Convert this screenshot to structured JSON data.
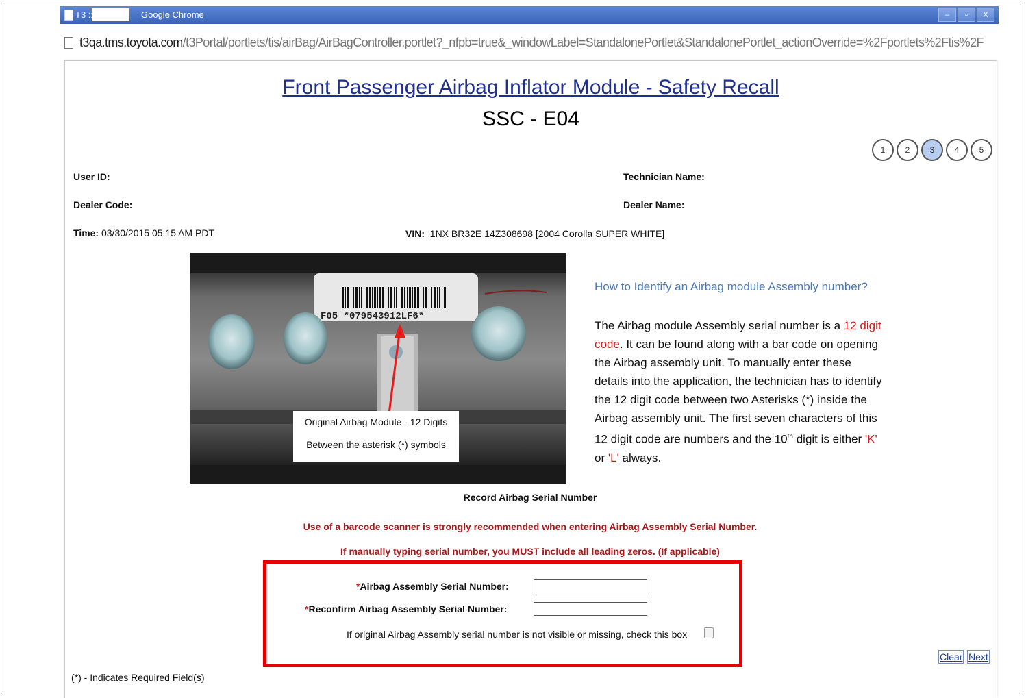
{
  "window": {
    "tab_title_prefix": "T3 ::",
    "app_name": "Google Chrome",
    "controls": [
      "–",
      "▫",
      "X"
    ]
  },
  "address_bar": {
    "host": "t3qa.tms.toyota.com",
    "path": "/t3Portal/portlets/tis/airBag/AirBagController.portlet?_nfpb=true&_windowLabel=StandalonePortlet&StandalonePortlet_actionOverride=%2Fportlets%2Ftis%2F"
  },
  "page": {
    "title": "Front Passenger Airbag Inflator Module - Safety Recall",
    "subtitle": "SSC - E04"
  },
  "steps": [
    {
      "label": "1",
      "active": false
    },
    {
      "label": "2",
      "active": false
    },
    {
      "label": "3",
      "active": true
    },
    {
      "label": "4",
      "active": false
    },
    {
      "label": "5",
      "active": false
    }
  ],
  "info": {
    "user_id_label": "User ID:",
    "dealer_code_label": "Dealer Code:",
    "time_label": "Time:",
    "time_value": "03/30/2015 05:15 AM PDT",
    "technician_name_label": "Technician Name:",
    "dealer_name_label": "Dealer Name:",
    "vin_label": "VIN:",
    "vin_value": "1NX BR32E 14Z308698 [2004 Corolla SUPER WHITE]"
  },
  "photo": {
    "label_code": "F05  *079543912LF6*",
    "callout_line1": "Original Airbag Module - 12 Digits",
    "callout_line2": "Between the asterisk (*) symbols"
  },
  "help": {
    "title": "How to Identify an Airbag module Assembly number?",
    "p1": "The Airbag module Assembly serial number is a ",
    "p1_red": "12 digit code",
    "p2": ". It can be found along with a bar code on opening the Airbag assembly unit. To manually enter these details into the application, the technician has to identify the 12 digit code between two Asterisks (*) inside the Airbag assembly unit. The first seven characters of this 12 digit code are numbers and the 10",
    "p2_sup": "th",
    "p3": " digit is either ",
    "p3_k": "'K'",
    "p3_or": " or ",
    "p3_l": "'L'",
    "p3_end": " always."
  },
  "record": {
    "title": "Record Airbag Serial Number",
    "warning1": "Use of a barcode scanner is strongly recommended when entering Airbag Assembly Serial Number.",
    "warning2": "If manually typing serial number, you MUST include all leading zeros. (If applicable)"
  },
  "form": {
    "required_mark": "*",
    "serial_label": "Airbag Assembly Serial Number:",
    "serial_value": "",
    "reconfirm_label": "Reconfirm Airbag Assembly Serial Number:",
    "reconfirm_value": "",
    "missing_label": "If original Airbag Assembly serial number is not visible or missing, check this box",
    "missing_checked": false
  },
  "buttons": {
    "clear": "Clear",
    "next": "Next"
  },
  "footer_note": "(*) - Indicates Required Field(s)",
  "colors": {
    "title_blue": "#1f2f8f",
    "warning_red": "#b0171b",
    "highlight_red": "#e60000",
    "help_blue": "#4a78b8"
  }
}
